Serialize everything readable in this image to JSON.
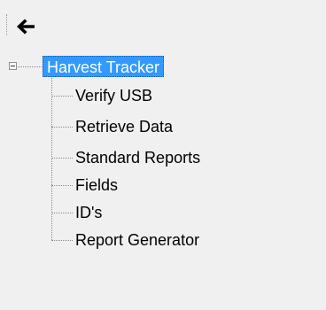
{
  "toolbar": {
    "back_icon": "back-arrow-icon"
  },
  "tree": {
    "root_label": "Harvest Tracker",
    "items": [
      {
        "label": "Verify USB"
      },
      {
        "label": "Retrieve Data"
      },
      {
        "label": "Standard Reports"
      },
      {
        "label": "Fields"
      },
      {
        "label": "ID's"
      },
      {
        "label": "Report Generator"
      }
    ]
  },
  "colors": {
    "window_bg": "#f0f0f0",
    "selection_bg": "#3399ff",
    "selection_text": "#ffffff"
  }
}
